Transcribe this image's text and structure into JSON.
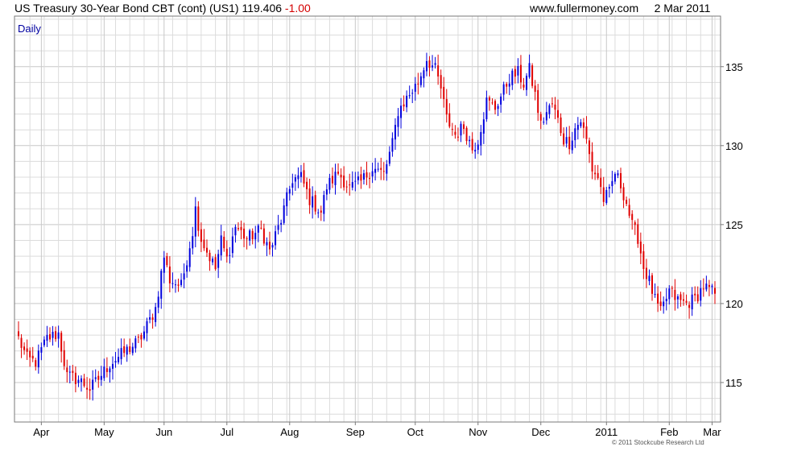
{
  "header": {
    "title": "US Treasury 30-Year  Bond CBT (cont) (US1)",
    "last_price": "119.406",
    "change": "-1.00",
    "website": "www.fullermoney.com",
    "date": "2 Mar 2011"
  },
  "footer": {
    "copyright": "© 2011 Stockcube Research Ltd"
  },
  "colors": {
    "up": "#0000dd",
    "down": "#e00000",
    "grid": "#dcdcdc",
    "frame": "#7a7a7a",
    "label_blue": "#0000a0"
  },
  "chart_data": {
    "type": "candlestick",
    "interval_label": "Daily",
    "ylim": [
      112.5,
      138.2
    ],
    "y_ticks": [
      115,
      120,
      125,
      130,
      135
    ],
    "x_tick_labels": [
      "Apr",
      "May",
      "Jun",
      "Jul",
      "Aug",
      "Sep",
      "Oct",
      "Nov",
      "Dec",
      "2011",
      "Feb",
      "Mar"
    ],
    "grid": true,
    "bar_count": 245,
    "close_anchors": [
      [
        0,
        117.8
      ],
      [
        3,
        116.5
      ],
      [
        6,
        116.3
      ],
      [
        10,
        117.8
      ],
      [
        14,
        118.1
      ],
      [
        17,
        115.4
      ],
      [
        21,
        115.2
      ],
      [
        25,
        114.6
      ],
      [
        27,
        115.0
      ],
      [
        32,
        116.2
      ],
      [
        37,
        116.9
      ],
      [
        42,
        117.6
      ],
      [
        44,
        118.2
      ],
      [
        48,
        119.7
      ],
      [
        51,
        123.0
      ],
      [
        53,
        121.5
      ],
      [
        57,
        121.1
      ],
      [
        61,
        124.6
      ],
      [
        62,
        126.0
      ],
      [
        64,
        124.1
      ],
      [
        66,
        123.3
      ],
      [
        69,
        122.2
      ],
      [
        71,
        124.0
      ],
      [
        73,
        122.8
      ],
      [
        76,
        124.9
      ],
      [
        80,
        124.1
      ],
      [
        85,
        124.7
      ],
      [
        88,
        123.3
      ],
      [
        92,
        125.3
      ],
      [
        96,
        127.9
      ],
      [
        99,
        128.0
      ],
      [
        102,
        126.6
      ],
      [
        106,
        125.8
      ],
      [
        108,
        127.4
      ],
      [
        112,
        128.3
      ],
      [
        116,
        127.3
      ],
      [
        120,
        127.7
      ],
      [
        124,
        128.6
      ],
      [
        128,
        128.2
      ],
      [
        131,
        130.1
      ],
      [
        133,
        132.2
      ],
      [
        136,
        133.0
      ],
      [
        140,
        134.0
      ],
      [
        143,
        135.5
      ],
      [
        146,
        134.8
      ],
      [
        148,
        133.6
      ],
      [
        150,
        131.7
      ],
      [
        153,
        130.7
      ],
      [
        156,
        131.2
      ],
      [
        159,
        129.8
      ],
      [
        161,
        130.4
      ],
      [
        164,
        132.8
      ],
      [
        167,
        132.4
      ],
      [
        170,
        133.5
      ],
      [
        172,
        134.3
      ],
      [
        175,
        134.6
      ],
      [
        177,
        133.9
      ],
      [
        179,
        134.8
      ],
      [
        181,
        133.2
      ],
      [
        183,
        131.3
      ],
      [
        185,
        132.1
      ],
      [
        187,
        132.6
      ],
      [
        189,
        131.6
      ],
      [
        191,
        130.4
      ],
      [
        193,
        130.2
      ],
      [
        195,
        131.1
      ],
      [
        197,
        131.6
      ],
      [
        199,
        130.3
      ],
      [
        201,
        128.5
      ],
      [
        203,
        128.0
      ],
      [
        205,
        126.6
      ],
      [
        207,
        127.0
      ],
      [
        209,
        128.3
      ],
      [
        211,
        127.5
      ],
      [
        213,
        126.4
      ],
      [
        215,
        124.9
      ],
      [
        217,
        124.2
      ],
      [
        219,
        122.3
      ],
      [
        221,
        121.4
      ],
      [
        223,
        120.2
      ],
      [
        225,
        119.4
      ],
      [
        228,
        120.8
      ],
      [
        231,
        120.2
      ],
      [
        234,
        120.0
      ],
      [
        237,
        120.3
      ],
      [
        240,
        121.1
      ],
      [
        244,
        120.6
      ]
    ]
  }
}
